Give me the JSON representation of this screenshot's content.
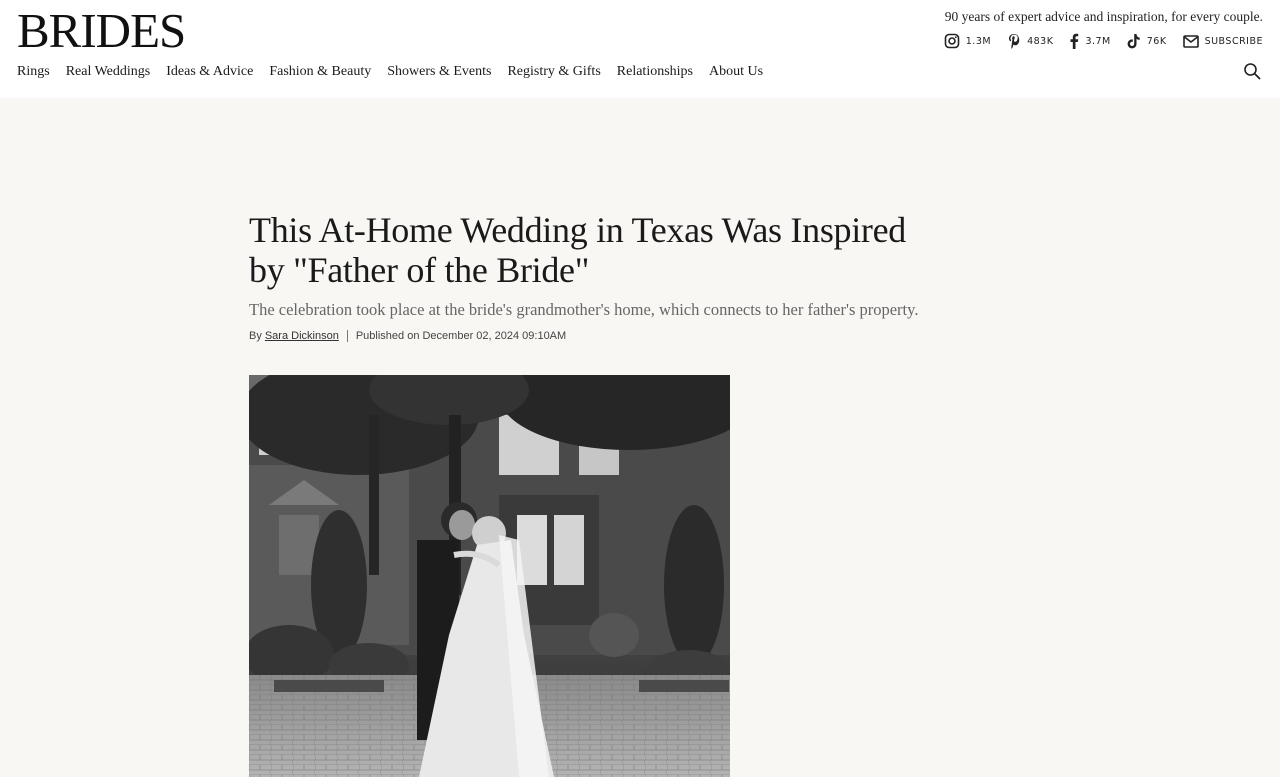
{
  "header": {
    "logo": "BRIDES",
    "tagline": "90 years of expert advice and inspiration, for every couple.",
    "social": [
      {
        "icon": "instagram-icon",
        "count": "1.3M"
      },
      {
        "icon": "pinterest-icon",
        "count": "483K"
      },
      {
        "icon": "facebook-icon",
        "count": "3.7M"
      },
      {
        "icon": "tiktok-icon",
        "count": "76K"
      },
      {
        "icon": "mail-icon",
        "count": "SUBSCRIBE"
      }
    ],
    "nav": [
      "Rings",
      "Real Weddings",
      "Ideas & Advice",
      "Fashion & Beauty",
      "Showers & Events",
      "Registry & Gifts",
      "Relationships",
      "About Us"
    ]
  },
  "article": {
    "title": "This At-Home Wedding in Texas Was Inspired by \"Father of the Bride\"",
    "dek": "The celebration took place at the bride's grandmother's home, which connects to her father's property.",
    "by_label": "By",
    "author": "Sara Dickinson",
    "published": "Published on December 02, 2024 09:10AM"
  }
}
